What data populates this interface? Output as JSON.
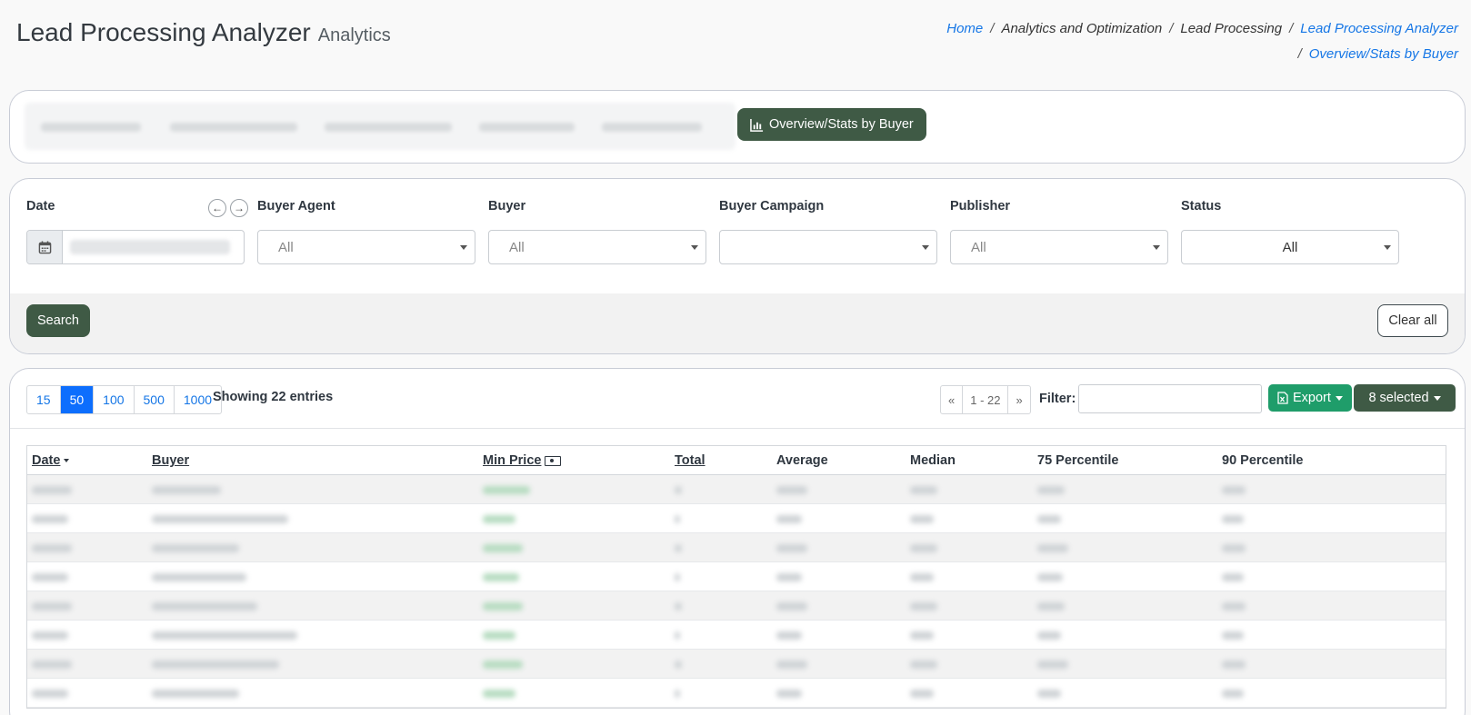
{
  "header": {
    "title": "Lead Processing Analyzer",
    "subtitle": "Analytics"
  },
  "breadcrumb": {
    "home": "Home",
    "sep": "/",
    "analytics": "Analytics and Optimization",
    "lead_processing": "Lead Processing",
    "analyzer": "Lead Processing Analyzer",
    "current": "Overview/Stats by Buyer"
  },
  "top_card": {
    "overview_button": "Overview/Stats by Buyer"
  },
  "filters": {
    "date_label": "Date",
    "buyer_agent_label": "Buyer Agent",
    "buyer_agent_value": "All",
    "buyer_label": "Buyer",
    "buyer_value": "All",
    "buyer_campaign_label": "Buyer Campaign",
    "buyer_campaign_value": "",
    "publisher_label": "Publisher",
    "publisher_value": "All",
    "status_label": "Status",
    "status_value": "All",
    "search_button": "Search",
    "clear_button": "Clear all"
  },
  "table_controls": {
    "page_sizes": [
      "15",
      "50",
      "100",
      "500",
      "1000"
    ],
    "active_page_size": "50",
    "showing": "Showing 22 entries",
    "pager_prev": "«",
    "pager_range": "1 - 22",
    "pager_next": "»",
    "filter_label": "Filter:",
    "filter_value": "",
    "export_button": "Export",
    "selected_button": "8 selected"
  },
  "table": {
    "columns": [
      "Date",
      "Buyer",
      "Min Price",
      "Total",
      "Average",
      "Median",
      "75 Percentile",
      "90 Percentile"
    ],
    "visible_rows": 8
  },
  "colors": {
    "primary_dark_green": "#3f5a45",
    "export_green": "#1f9d6a",
    "link_blue": "#1576e6",
    "active_blue": "#0d6efd"
  }
}
